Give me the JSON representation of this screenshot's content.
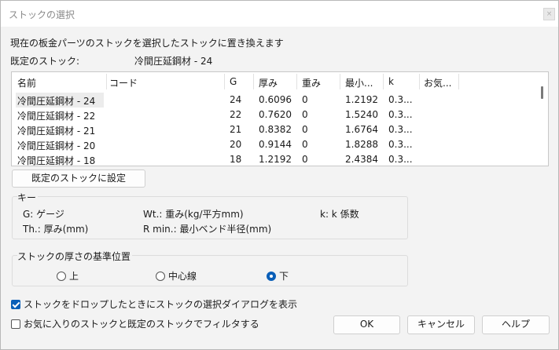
{
  "window": {
    "title": "ストックの選択",
    "close_glyph": "×"
  },
  "description": "現在の板金パーツのストックを選択したストックに置き換えます",
  "default_stock": {
    "label": "既定のストック:",
    "value": "冷間圧延鋼材 - 24"
  },
  "table": {
    "columns": [
      "名前",
      "コード",
      "G",
      "厚み",
      "重み",
      "最小...",
      "k",
      "お気..."
    ],
    "rows": [
      [
        "冷間圧延鋼材 - 24",
        "",
        "24",
        "0.6096",
        "0",
        "1.2192",
        "0.3...",
        ""
      ],
      [
        "冷間圧延鋼材 - 22",
        "",
        "22",
        "0.7620",
        "0",
        "1.5240",
        "0.3...",
        ""
      ],
      [
        "冷間圧延鋼材 - 21",
        "",
        "21",
        "0.8382",
        "0",
        "1.6764",
        "0.3...",
        ""
      ],
      [
        "冷間圧延鋼材 - 20",
        "",
        "20",
        "0.9144",
        "0",
        "1.8288",
        "0.3...",
        ""
      ],
      [
        "冷間圧延鋼材 - 18",
        "",
        "18",
        "1.2192",
        "0",
        "2.4384",
        "0.3...",
        ""
      ]
    ]
  },
  "set_default_button": "既定のストックに設定",
  "key": {
    "title": "キー",
    "g": "G: ゲージ",
    "th": "Th.: 厚み(mm)",
    "wt": "Wt.: 重み(kg/平方mm)",
    "rmin": "R min.: 最小ベンド半径(mm)",
    "k": "k: k 係数"
  },
  "thickness_ref": {
    "title": "ストックの厚さの基準位置",
    "options": [
      "上",
      "中心線",
      "下"
    ],
    "selected": "下"
  },
  "checkboxes": {
    "show_dialog": {
      "label": "ストックをドロップしたときにストックの選択ダイアログを表示",
      "checked": true
    },
    "filter_favorites": {
      "label": "お気に入りのストックと既定のストックでフィルタする",
      "checked": false
    }
  },
  "buttons": {
    "ok": "OK",
    "cancel": "キャンセル",
    "help": "ヘルプ"
  }
}
